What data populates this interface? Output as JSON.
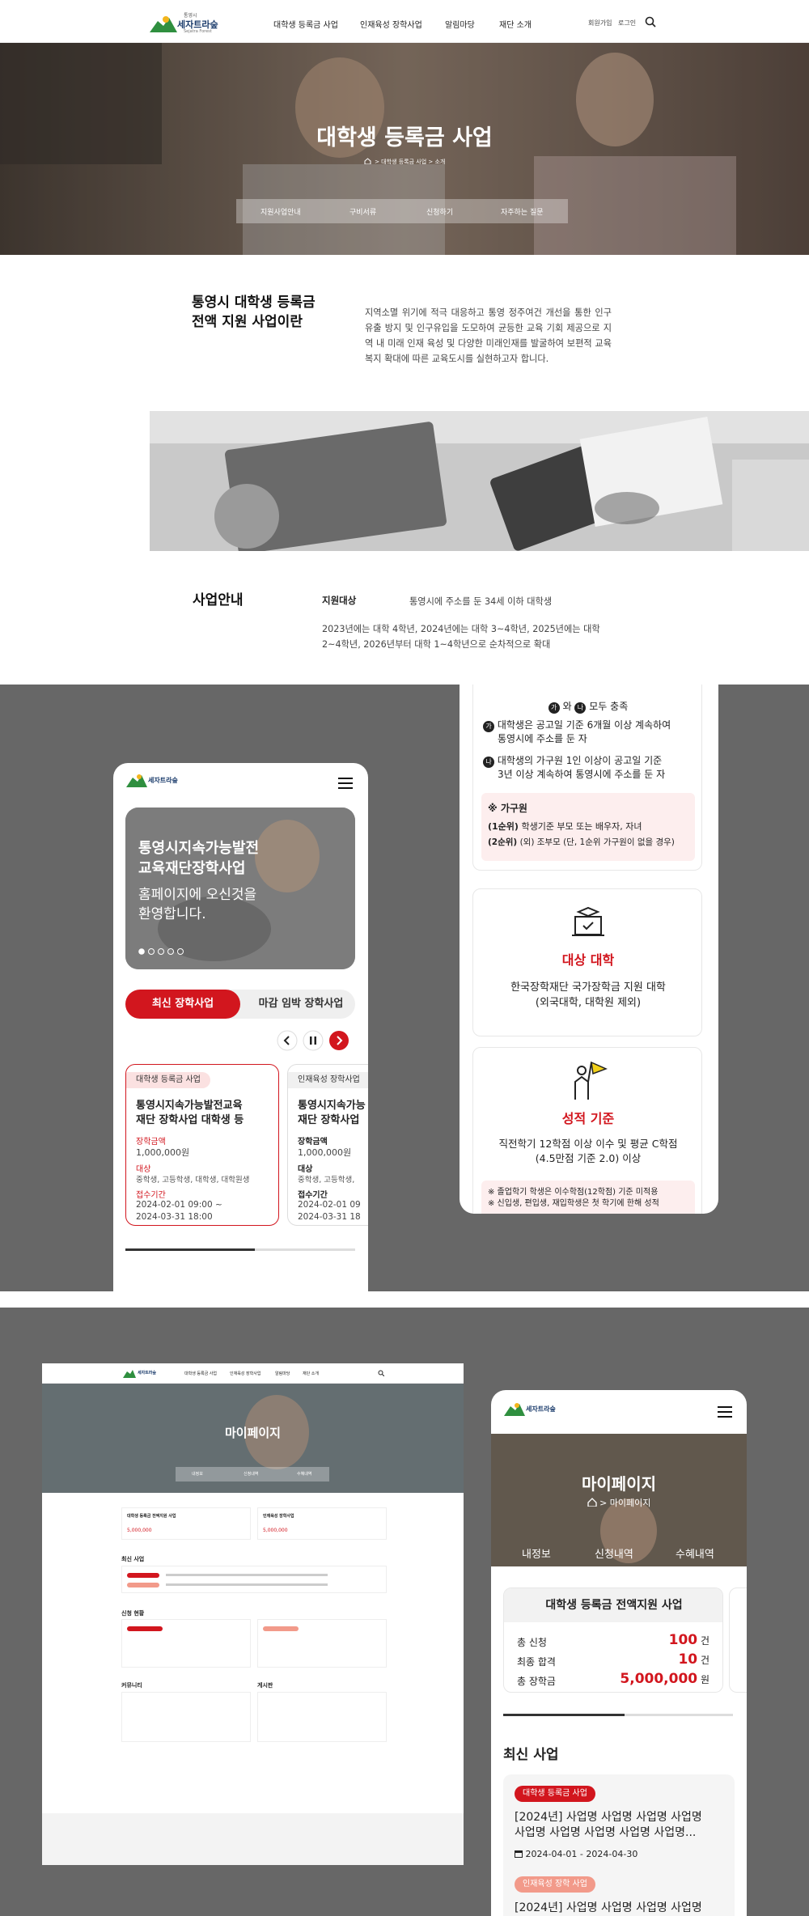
{
  "header": {
    "logo": "세자트라숲",
    "logo_top": "통영시",
    "logo_sub": "Sejatra Forest",
    "nav": [
      "대학생 등록금 사업",
      "인재육성 장학사업",
      "알림마당",
      "재단 소개"
    ],
    "join": "회원가입",
    "login": "로그인"
  },
  "hero": {
    "title": "대학생 등록금 사업",
    "crumb1": "대학생 등록금 사업",
    "crumb2": "소개",
    "tabs": [
      "지원사업안내",
      "구비서류",
      "신청하기",
      "자주하는 질문"
    ]
  },
  "intro": {
    "title1": "통영시 대학생 등록금",
    "title2": "전액 지원 사업이란",
    "body": "지역소멸 위기에 적극 대응하고 통영 정주여건 개선을 통한 인구유출 방지 및 인구유입을 도모하여 균등한 교육 기회 제공으로 지역 내 미래 인재 육성 및 다양한 미래인재를 발굴하여 보편적 교육복지 확대에 따른 교육도시를 실현하고자 합니다."
  },
  "guide": {
    "title": "사업안내",
    "label": "지원대상",
    "value": "통영시에 주소를 둔 34세 이하 대학생",
    "note": "2023년에는 대학 4학년, 2024년에는 대학 3~4학년, 2025년에는 대학 2~4학년, 2026년부터 대학 1~4학년으로 순차적으로 확대"
  },
  "mobile1": {
    "slide_title1": "통영시지속가능발전",
    "slide_title2": "교육재단장학사업",
    "slide_sub1": "홈페이지에 오신것을",
    "slide_sub2": "환영합니다.",
    "tab_on": "최신 장학사업",
    "tab_off": "마감 임박 장학사업",
    "cards": [
      {
        "badge": "대학생 등록금 사업",
        "title1": "통영시지속가능발전교육",
        "title2": "재단 장학사업 대학생 등",
        "amount_label": "장학금액",
        "amount": "1,000,000원",
        "target_label": "대상",
        "target": "중학생, 고등학생, 대학생, 대학원생",
        "period_label": "접수기간",
        "period1": "2024-02-01 09:00 ~",
        "period2": "2024-03-31 18:00"
      },
      {
        "badge": "인재육성 장학사업",
        "title1": "통영시지속가능",
        "title2": "재단 장학사업",
        "amount_label": "장학금액",
        "amount": "1,000,000원",
        "target_label": "대상",
        "target": "중학생, 고등학생,",
        "period_label": "접수기간",
        "period1": "2024-02-01 09",
        "period2": "2024-03-31 18"
      }
    ]
  },
  "mobile2": {
    "cond_head": "모두 충족",
    "cond_a": "와",
    "cond1a": "대학생은 공고일 기준 6개월 이상 계속하여",
    "cond1b": "통영시에 주소를 둔 자",
    "cond2a": "대학생의 가구원 1인 이상이 공고일 기준",
    "cond2b": "3년 이상 계속하여 통영시에 주소를 둔 자",
    "household": "※ 가구원",
    "rank1": "(1순위)",
    "rank1_t": "학생기준 부모 또는 배우자, 자녀",
    "rank2": "(2순위)",
    "rank2_t": "(외) 조부모 (단, 1순위 가구원이 없을 경우)",
    "target_title": "대상 대학",
    "target_t1": "한국장학재단 국가장학금 지원 대학",
    "target_t2": "(외국대학, 대학원 제외)",
    "grade_title": "성적 기준",
    "grade_t1": "직전학기 12학점 이상 이수 및 평균 C학점",
    "grade_t2": "(4.5만점 기준 2.0) 이상",
    "grade_n1": "※ 졸업학기 학생은 이수학점(12학점) 기준 미적용",
    "grade_n2": "※ 신입생, 편입생, 재입학생은 첫 학기에 한해 성적"
  },
  "desktop": {
    "title": "마이페이지",
    "tabs": [
      "내정보",
      "신청내역",
      "수혜내역"
    ],
    "sec1": "최신 사업",
    "sec2": "신청 현황",
    "sec3": "커뮤니티",
    "sec4": "게시판",
    "stat1": "대학생 등록금 전액지원 사업",
    "stat2": "인재육성 장학사업"
  },
  "mobile3": {
    "title": "마이페이지",
    "crumb": "마이페이지",
    "tabs": [
      "내정보",
      "신청내역",
      "수혜내역"
    ],
    "stat_title": "대학생 등록금 전액지원 사업",
    "apply_label": "총 신청",
    "apply_v": "100",
    "apply_u": "건",
    "pass_label": "최종 합격",
    "pass_v": "10",
    "pass_u": "건",
    "amt_label": "총 장학금",
    "amt_v": "5,000,000",
    "amt_u": "원",
    "recent": "최신 사업",
    "b1": "대학생 등록금 사업",
    "r1a": "[2024년] 사업명 사업명 사업명 사업명",
    "r1b": "사업명 사업명 사업명 사업명 사업명...",
    "d1": "2024-04-01 - 2024-04-30",
    "b2": "인재육성 장학 사업",
    "r2": "[2024년] 사업명 사업명 사업명 사업명"
  }
}
